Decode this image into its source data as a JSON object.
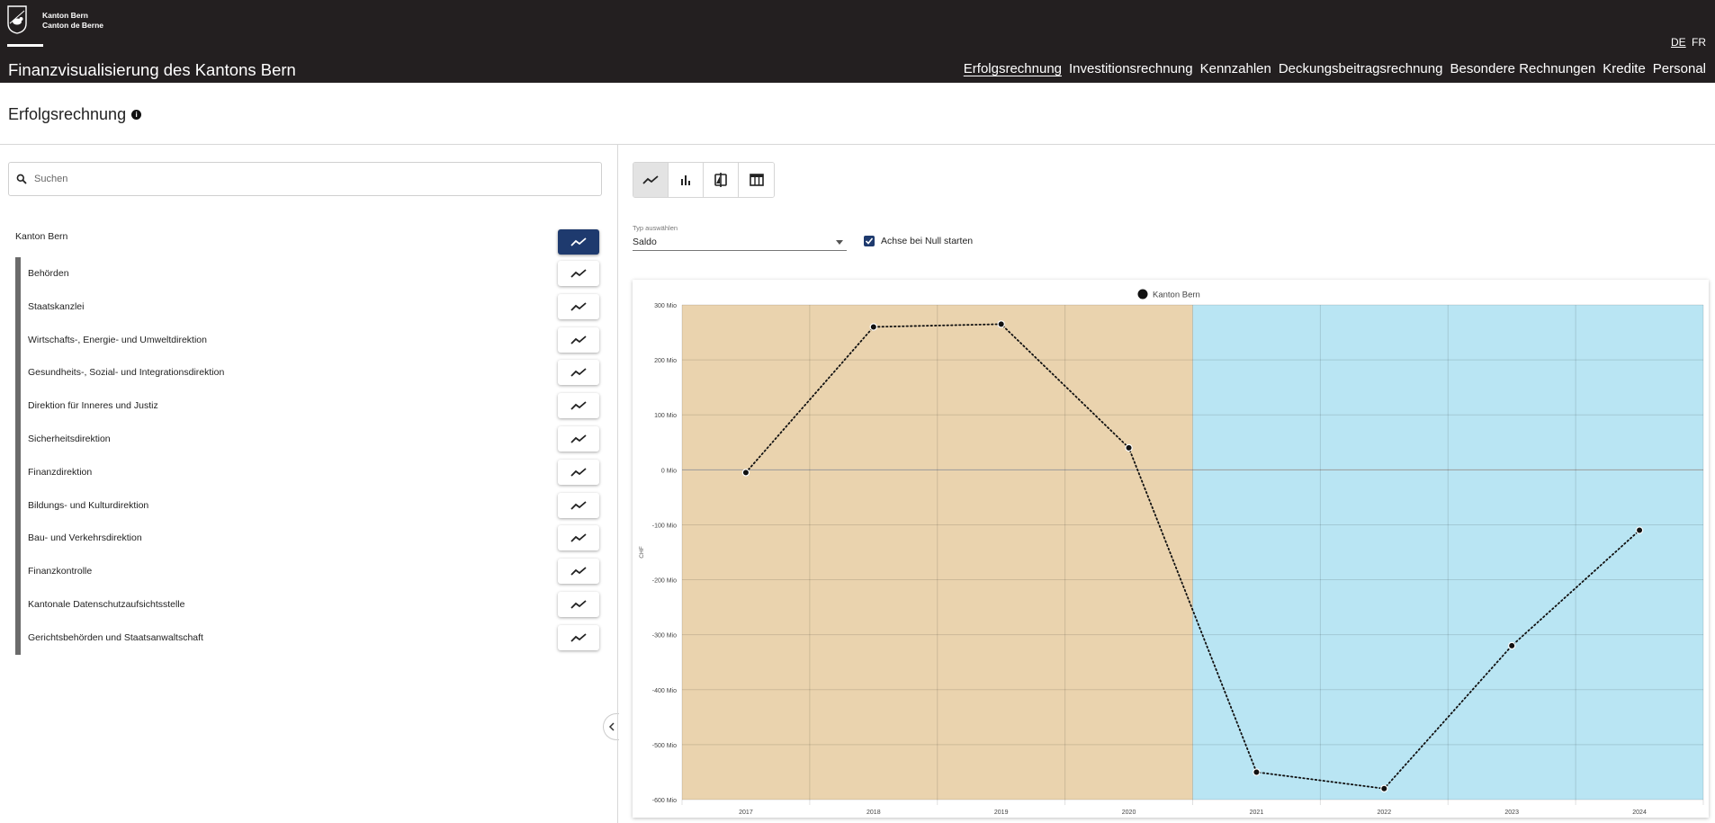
{
  "header": {
    "brand_line1": "Kanton Bern",
    "brand_line2": "Canton de Berne",
    "site_title": "Finanzvisualisierung des Kantons Bern",
    "lang_de": "DE",
    "lang_fr": "FR",
    "nav": [
      {
        "label": "Erfolgsrechnung",
        "active": true
      },
      {
        "label": "Investitionsrechnung"
      },
      {
        "label": "Kennzahlen"
      },
      {
        "label": "Deckungsbeitragsrechnung"
      },
      {
        "label": "Besondere Rechnungen"
      },
      {
        "label": "Kredite"
      },
      {
        "label": "Personal"
      }
    ]
  },
  "page": {
    "title": "Erfolgsrechnung",
    "info_glyph": "i"
  },
  "sidebar": {
    "search_placeholder": "Suchen",
    "root": "Kanton Bern",
    "items": [
      "Behörden",
      "Staatskanzlei",
      "Wirtschafts-, Energie- und Umweltdirektion",
      "Gesundheits-, Sozial- und Integrationsdirektion",
      "Direktion für Inneres und Justiz",
      "Sicherheitsdirektion",
      "Finanzdirektion",
      "Bildungs- und Kulturdirektion",
      "Bau- und Verkehrsdirektion",
      "Finanzkontrolle",
      "Kantonale Datenschutzaufsichtsstelle",
      "Gerichtsbehörden und Staatsanwaltschaft"
    ]
  },
  "controls": {
    "type_label": "Typ auswählen",
    "type_value": "Saldo",
    "zero_axis_label": "Achse bei Null starten",
    "zero_axis_checked": true
  },
  "colors": {
    "header_bg": "#231f20",
    "accent": "#1e3a6e",
    "actual_bg": "#ead3ae",
    "budget_bg": "#b9e5f3"
  },
  "chart_data": {
    "type": "line",
    "legend": "Kanton Bern",
    "ylabel": "CHF",
    "x": [
      "2017",
      "2018",
      "2019",
      "2020",
      "2021",
      "2022",
      "2023",
      "2024"
    ],
    "series": [
      {
        "name": "Kanton Bern",
        "values": [
          -5,
          260,
          265,
          40,
          -550,
          -580,
          -320,
          -110
        ]
      }
    ],
    "ylim": [
      -600,
      300
    ],
    "yticks": [
      300,
      200,
      100,
      0,
      -100,
      -200,
      -300,
      -400,
      -500,
      -600
    ],
    "ytick_labels": [
      "300 Mio",
      "200 Mio",
      "100 Mio",
      "0 Mio",
      "-100 Mio",
      "-200 Mio",
      "-300 Mio",
      "-400 Mio",
      "-500 Mio",
      "-600 Mio"
    ],
    "grid": true,
    "shaded_ranges": [
      {
        "from": "2017",
        "to": "2020",
        "kind": "actual"
      },
      {
        "from": "2021",
        "to": "2024",
        "kind": "budget"
      }
    ]
  }
}
